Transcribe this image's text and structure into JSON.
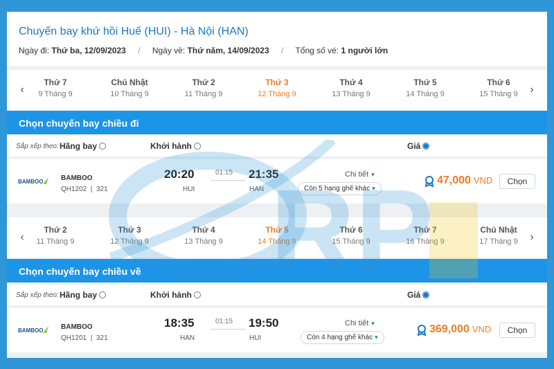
{
  "header": {
    "title": "Chuyến bay khứ hồi Huế (HUI) - Hà Nội (HAN)",
    "depart_label": "Ngày đi:",
    "depart_value": "Thứ ba, 12/09/2023",
    "return_label": "Ngày về:",
    "return_value": "Thứ năm, 14/09/2023",
    "tickets_label": "Tổng số vé:",
    "tickets_value": "1 người lớn"
  },
  "outbound": {
    "days": [
      {
        "name": "Thứ 7",
        "date": "9 Tháng 9"
      },
      {
        "name": "Chủ Nhật",
        "date": "10 Tháng 9"
      },
      {
        "name": "Thứ 2",
        "date": "11 Tháng 9"
      },
      {
        "name": "Thứ 3",
        "date": "12 Tháng 9"
      },
      {
        "name": "Thứ 4",
        "date": "13 Tháng 9"
      },
      {
        "name": "Thứ 5",
        "date": "14 Tháng 9"
      },
      {
        "name": "Thứ 6",
        "date": "15 Tháng 9"
      }
    ],
    "active_index": 3,
    "section_title": "Chọn chuyến bay chiều đi",
    "flight": {
      "airline": "BAMBOO",
      "code": "QH1202",
      "aircraft": "321",
      "dep_time": "20:20",
      "dep_airport": "HUI",
      "duration": "01:15",
      "arr_time": "21:35",
      "arr_airport": "HAN",
      "detail": "Chi tiết",
      "seats": "Còn 5 hạng ghế khác",
      "price": "47,000",
      "currency": "VND",
      "choose": "Chọn"
    }
  },
  "inbound": {
    "days": [
      {
        "name": "Thứ 2",
        "date": "11 Tháng 9"
      },
      {
        "name": "Thứ 3",
        "date": "12 Tháng 9"
      },
      {
        "name": "Thứ 4",
        "date": "13 Tháng 9"
      },
      {
        "name": "Thứ 5",
        "date": "14 Tháng 9"
      },
      {
        "name": "Thứ 6",
        "date": "15 Tháng 9"
      },
      {
        "name": "Thứ 7",
        "date": "16 Tháng 9"
      },
      {
        "name": "Chủ Nhật",
        "date": "17 Tháng 9"
      }
    ],
    "active_index": 3,
    "section_title": "Chọn chuyến bay chiều về",
    "flight": {
      "airline": "BAMBOO",
      "code": "QH1201",
      "aircraft": "321",
      "dep_time": "18:35",
      "dep_airport": "HAN",
      "duration": "01:15",
      "arr_time": "19:50",
      "arr_airport": "HUI",
      "detail": "Chi tiết",
      "seats": "Còn 4 hạng ghế khác",
      "price": "369,000",
      "currency": "VND",
      "choose": "Chọn"
    }
  },
  "sort": {
    "label": "Sắp xếp theo:",
    "airline": "Hãng bay",
    "departure": "Khởi hành",
    "price": "Giá",
    "selected": "price"
  },
  "colors": {
    "accent": "#1c94e8",
    "title_blue": "#1a78c2",
    "price_orange": "#f07b22",
    "background": "#2f96d7"
  },
  "watermark": {
    "text": "RP"
  },
  "icons": {
    "prev": "chevron-left-icon",
    "next": "chevron-right-icon",
    "price_tag": "price-tag-icon",
    "logo": "bamboo-airways-logo"
  }
}
